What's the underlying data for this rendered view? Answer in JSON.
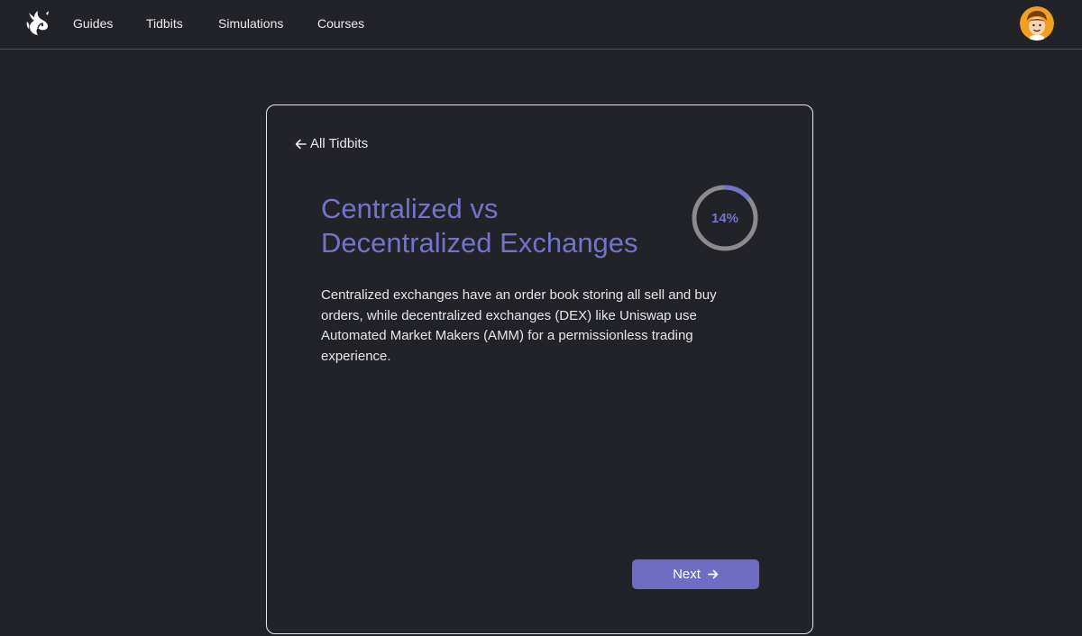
{
  "nav": {
    "logo_icon": "unicorn-logo-icon",
    "links": [
      "Guides",
      "Tidbits",
      "Simulations",
      "Courses"
    ],
    "avatar_icon": "user-avatar-icon"
  },
  "card": {
    "back_label": "All Tidbits",
    "title_line1": "Centralized vs",
    "title_line2": "Decentralized Exchanges",
    "progress": {
      "percent": 14,
      "label": "14%"
    },
    "body": "Centralized exchanges have an order book storing all sell and buy orders, while decentralized exchanges (DEX) like Uniswap use Automated Market Makers (AMM) for a permissionless trading experience.",
    "next_label": "Next"
  },
  "colors": {
    "background": "#222328",
    "accent": "#7373c7",
    "button": "#6f6cc4",
    "ring_track": "#8a8a8f",
    "border": "#e8e8ec"
  }
}
